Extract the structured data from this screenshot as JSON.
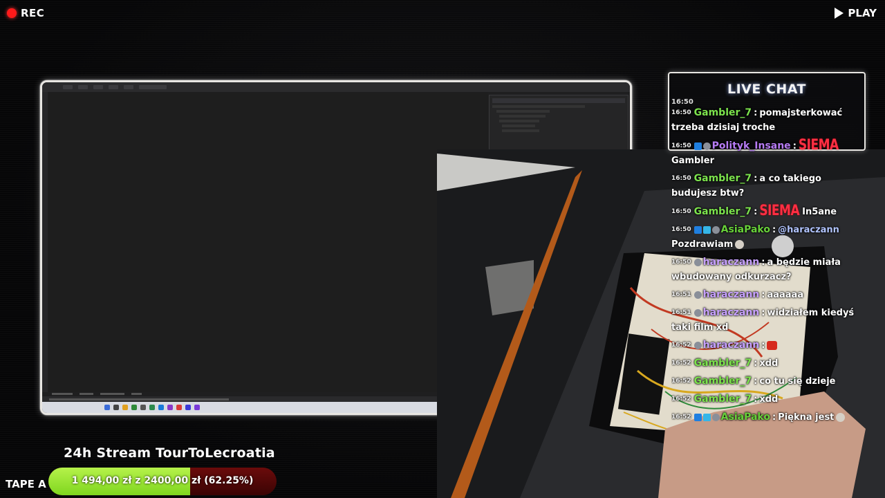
{
  "overlay": {
    "rec_label": "REC",
    "play_label": "PLAY",
    "tape_label": "TAPE A",
    "stream_title": "24h Stream TourToLecroatia"
  },
  "donation": {
    "text": "1 494,00 zł z 2400,00 zł (62.25%)",
    "progress_percent": 62.25,
    "fill_color": "#a6ec3a",
    "empty_color": "#5a0808"
  },
  "chat": {
    "title": "LIVE CHAT",
    "messages": [
      {
        "time": "16:50",
        "user": "Gambler_7",
        "color": "green",
        "text": "pomajsterkować trzeba dzisiaj troche"
      },
      {
        "time": "16:50",
        "user": "Polityk_Insane",
        "color": "purple",
        "badges": [
          "b-blue",
          "b-gray"
        ],
        "emote": "SIEMA",
        "text": "Gambler"
      },
      {
        "time": "16:50",
        "user": "Gambler_7",
        "color": "green",
        "text": "a co takiego budujesz btw?"
      },
      {
        "time": "16:50",
        "user": "Gambler_7",
        "color": "green",
        "emote": "SIEMA",
        "text": "In5ane"
      },
      {
        "time": "16:50",
        "user": "AsiaPako",
        "color": "lime",
        "badges": [
          "b-blue",
          "b-cyan",
          "b-gray"
        ],
        "mention": "@haraczann",
        "text": "Pozdrawiam"
      },
      {
        "time": "16:50",
        "user": "haraczann",
        "color": "lav",
        "badges": [
          "b-gray"
        ],
        "text": "a będzie miała wbudowany odkurzacz?"
      },
      {
        "time": "16:51",
        "user": "haraczann",
        "color": "lav",
        "badges": [
          "b-gray"
        ],
        "text": "aaaaaa"
      },
      {
        "time": "16:51",
        "user": "haraczann",
        "color": "lav",
        "badges": [
          "b-gray"
        ],
        "text": "widziałem kiedyś taki film xd"
      },
      {
        "time": "16:52",
        "user": "haraczann",
        "color": "lav",
        "badges": [
          "b-gray"
        ],
        "text": ""
      },
      {
        "time": "16:52",
        "user": "Gambler_7",
        "color": "green",
        "text": "xdd"
      },
      {
        "time": "16:52",
        "user": "Gambler_7",
        "color": "green",
        "text": "co tu się dzieje"
      },
      {
        "time": "16:52",
        "user": "Gambler_7",
        "color": "green",
        "text": "xdd"
      },
      {
        "time": "16:52",
        "user": "AsiaPako",
        "color": "lime",
        "badges": [
          "b-blue",
          "b-cyan",
          "b-gray"
        ],
        "text": "Piękna jest"
      }
    ]
  }
}
